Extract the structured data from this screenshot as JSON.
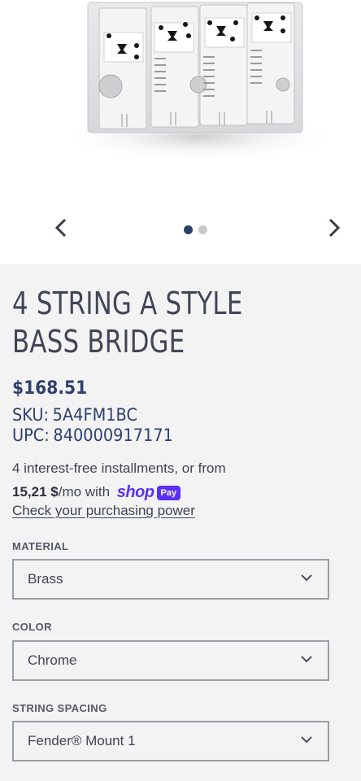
{
  "product": {
    "title": "4 STRING A STYLE BASS BRIDGE",
    "price": "$168.51",
    "sku_label": "SKU:",
    "sku_value": "5A4FM1BC",
    "upc_label": "UPC:",
    "upc_value": "840000917171"
  },
  "gallery": {
    "image_alt": "4 string A style bass bridge product photo",
    "dots_count": 2,
    "active_dot_index": 0,
    "prev_icon": "chevron-left-icon",
    "next_icon": "chevron-right-icon"
  },
  "installments": {
    "line1": "4 interest-free installments, or from",
    "amount": "15,21 $",
    "per_month": "/mo with",
    "shop_word": "shop",
    "pay_word": "Pay",
    "link": "Check your purchasing power"
  },
  "options": {
    "material": {
      "label": "MATERIAL",
      "value": "Brass"
    },
    "color": {
      "label": "COLOR",
      "value": "Chrome"
    },
    "spacing": {
      "label": "STRING SPACING",
      "value": "Fender® Mount 1"
    }
  },
  "colors": {
    "accent": "#2f4070",
    "shop_pay": "#5a31f4",
    "background": "#f3f3f4"
  }
}
